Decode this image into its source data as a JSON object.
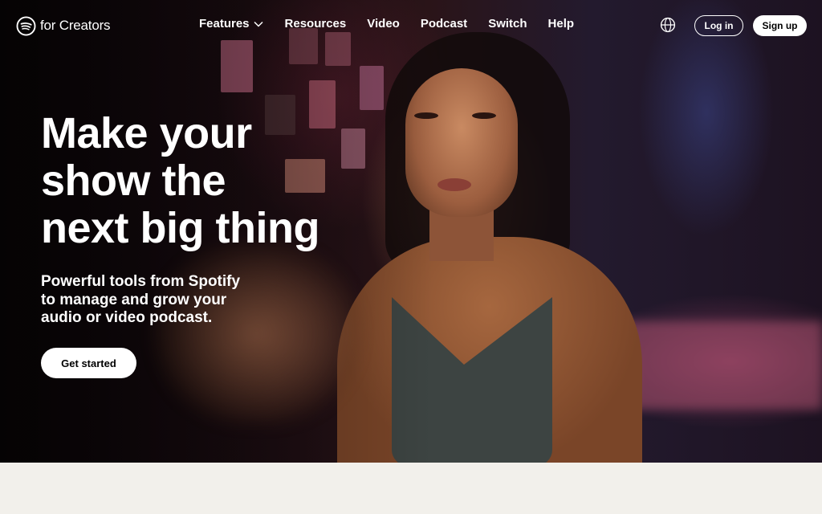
{
  "brand": {
    "logo_text": "for Creators",
    "logo_icon": "spotify-logo-icon"
  },
  "nav": {
    "items": [
      {
        "label": "Features",
        "has_dropdown": true
      },
      {
        "label": "Resources"
      },
      {
        "label": "Video"
      },
      {
        "label": "Podcast"
      },
      {
        "label": "Switch"
      },
      {
        "label": "Help"
      }
    ],
    "language_icon": "globe-icon",
    "login_label": "Log in",
    "signup_label": "Sign up"
  },
  "hero": {
    "headline_lines": [
      "Make your",
      "show the",
      "next big thing"
    ],
    "subtext_lines": [
      "Powerful tools from Spotify",
      "to manage and grow your",
      "audio or video podcast."
    ],
    "cta_label": "Get started"
  },
  "colors": {
    "text_on_hero": "#ffffff",
    "button_bg": "#ffffff",
    "lower_section_bg": "#f2f0eb"
  }
}
